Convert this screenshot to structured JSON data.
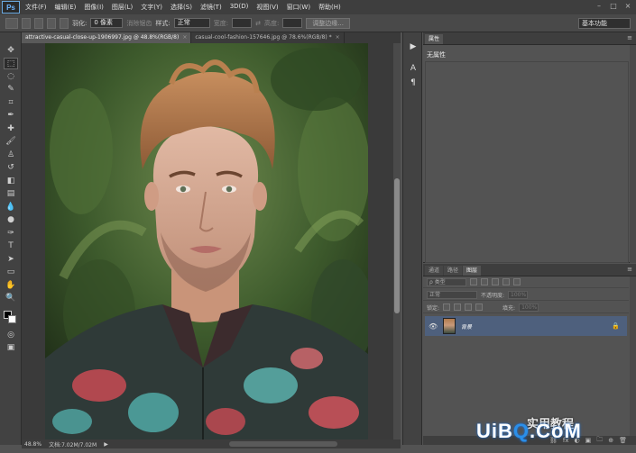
{
  "app": {
    "logo": "Ps",
    "menu": [
      "文件(F)",
      "编辑(E)",
      "图像(I)",
      "图层(L)",
      "文字(Y)",
      "选择(S)",
      "滤镜(T)",
      "3D(D)",
      "视图(V)",
      "窗口(W)",
      "帮助(H)"
    ],
    "window_controls": [
      "–",
      "□",
      "×"
    ]
  },
  "options_bar": {
    "feather_label": "羽化:",
    "feather_value": "0 像素",
    "antialias_label": "消除锯齿",
    "style_label": "样式:",
    "style_value": "正常",
    "width_label": "宽度:",
    "height_label": "高度:",
    "refine_edge_button": "调整边缘...",
    "workspace": "基本功能"
  },
  "documents": {
    "tabs": [
      {
        "label": "attractive-casual-close-up-1906997.jpg @ 48.8%(RGB/8)",
        "close": "×"
      },
      {
        "label": "casual-cool-fashion-157646.jpg @ 78.6%(RGB/8) *",
        "close": "×"
      }
    ]
  },
  "status_bar": {
    "zoom": "48.8%",
    "doc_info": "文档:7.02M/7.02M",
    "arrow": "▶"
  },
  "properties_panel": {
    "tab": "属性",
    "label": "无属性"
  },
  "layers_panel": {
    "tabs": [
      "通道",
      "路径",
      "图层"
    ],
    "filter_label": "ρ 类型",
    "blend_mode": "正常",
    "opacity_label": "不透明度:",
    "opacity_value": "100%",
    "lock_label": "锁定:",
    "fill_label": "填充:",
    "fill_value": "100%",
    "layer": {
      "name": "背景",
      "visible_icon": "👁",
      "lock_icon": "🔒"
    },
    "footer_icons": [
      "⛓",
      "fx",
      "◐",
      "▣",
      "🗀",
      "⊕",
      "🗑"
    ]
  },
  "watermark": {
    "site_prefix": "UiB",
    "site_q": "Q",
    "site_suffix": ".CoM",
    "text": "实用教程"
  },
  "colors": {
    "foreground": "#000000",
    "background": "#ffffff",
    "selected_layer": "#4e607d"
  }
}
